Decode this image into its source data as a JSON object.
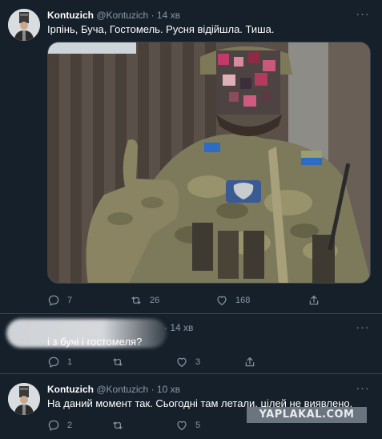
{
  "tweets": [
    {
      "name": "Kontuzich",
      "handle": "@Kontuzich",
      "dot": "·",
      "time": "14 хв",
      "text": "Ірпінь, Буча, Гостомель. Русня відійшла. Тиша.",
      "replies": "7",
      "retweets": "26",
      "likes": "168"
    },
    {
      "dot": "·",
      "time": "14 хв",
      "text": "і з бучі і гостомеля?",
      "replies": "1",
      "retweets": "",
      "likes": "3"
    },
    {
      "name": "Kontuzich",
      "handle": "@Kontuzich",
      "dot": "·",
      "time": "10 хв",
      "text": "На даний момент так. Сьогодні там летали, цілей не виявлено.",
      "replies": "2",
      "retweets": "",
      "likes": "5"
    }
  ],
  "more_label": "···",
  "watermark": "YAPLAKAL.COM",
  "icons": {
    "reply": "reply-icon",
    "retweet": "retweet-icon",
    "like": "like-icon",
    "share": "share-icon"
  },
  "colors": {
    "background": "#15202b",
    "secondary_text": "#8899a6",
    "divider": "#38444d"
  }
}
